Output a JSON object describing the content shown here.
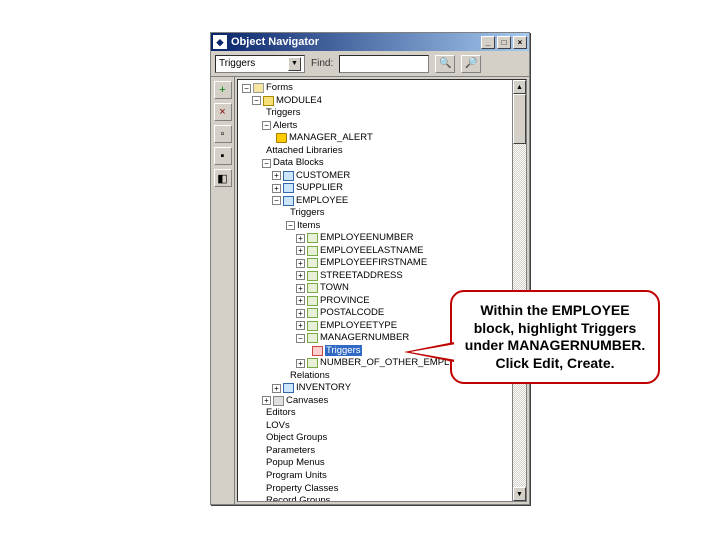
{
  "window": {
    "title": "Object Navigator",
    "min": "_",
    "max": "□",
    "close": "×"
  },
  "toolbar": {
    "category": "Triggers",
    "find_label": "Find:",
    "find_value": ""
  },
  "sidebar": {
    "create": "+",
    "delete": "×",
    "expand": "▫",
    "collapse": "▪",
    "other": "◧"
  },
  "tree": {
    "root": "Forms",
    "module": "MODULE4",
    "triggers": "Triggers",
    "alerts": "Alerts",
    "alert1": "MANAGER_ALERT",
    "attached_libs": "Attached Libraries",
    "data_blocks": "Data Blocks",
    "block_customer": "CUSTOMER",
    "block_supplier": "SUPPLIER",
    "block_employee": "EMPLOYEE",
    "emp_triggers": "Triggers",
    "emp_items": "Items",
    "it_empno": "EMPLOYEENUMBER",
    "it_last": "EMPLOYEELASTNAME",
    "it_first": "EMPLOYEEFIRSTNAME",
    "it_street": "STREETADDRESS",
    "it_town": "TOWN",
    "it_prov": "PROVINCE",
    "it_postal": "POSTALCODE",
    "it_type": "EMPLOYEETYPE",
    "it_mgr": "MANAGERNUMBER",
    "it_mgr_trig": "Triggers",
    "it_count": "NUMBER_OF_OTHER_EMPLOYEES",
    "relations": "Relations",
    "block_inventory": "INVENTORY",
    "canvases": "Canvases",
    "editors": "Editors",
    "lovs": "LOVs",
    "object_groups": "Object Groups",
    "parameters": "Parameters",
    "popup_menus": "Popup Menus",
    "program_units": "Program Units",
    "prop_classes": "Property Classes",
    "record_groups": "Record Groups"
  },
  "callout": {
    "text": "Within the EMPLOYEE block, highlight Triggers under MANAGERNUMBER. Click Edit, Create."
  }
}
